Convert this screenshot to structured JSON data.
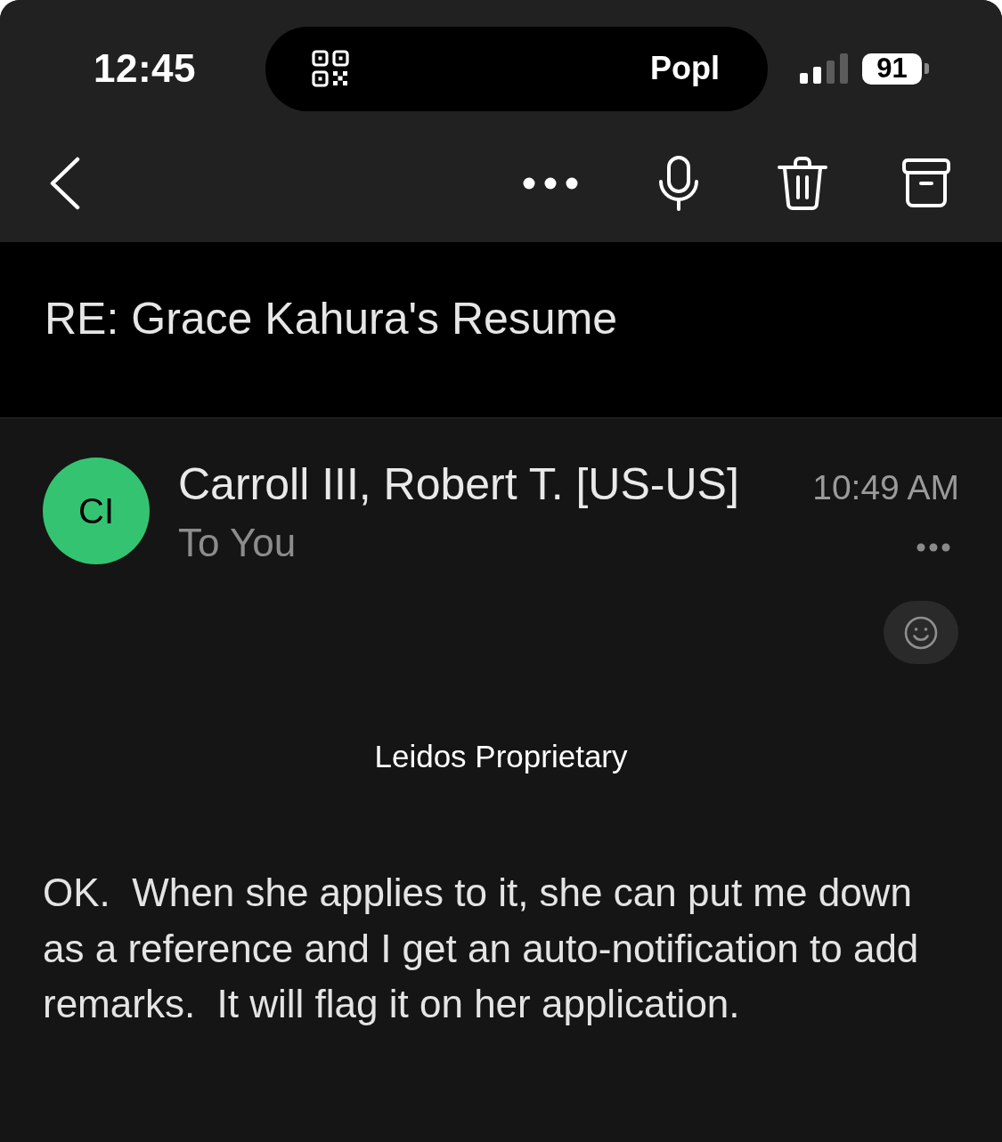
{
  "status_bar": {
    "time": "12:45",
    "live_activity": {
      "label": "Popl"
    },
    "battery": "91"
  },
  "subject": "RE: Grace Kahura's Resume",
  "message": {
    "sender": {
      "initials": "CI",
      "name": "Carroll III, Robert T. [US-US]"
    },
    "recipients": "To You",
    "time": "10:49 AM",
    "classification": "Leidos Proprietary",
    "body": "OK.  When she applies to it, she can put me down as a reference and I get an auto-notification to add remarks.  It will flag it on her application."
  }
}
